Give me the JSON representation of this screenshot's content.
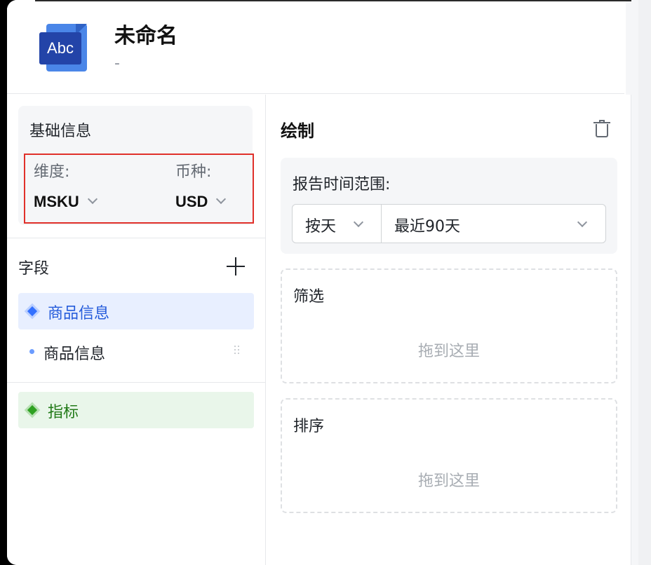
{
  "header": {
    "icon_text": "Abc",
    "title": "未命名",
    "subtitle": "-"
  },
  "basic_info": {
    "title": "基础信息",
    "dimension_label": "维度:",
    "dimension_value": "MSKU",
    "currency_label": "币种:",
    "currency_value": "USD"
  },
  "fields": {
    "title": "字段",
    "groups": [
      {
        "label": "商品信息",
        "color": "#3370ff"
      },
      {
        "label": "指标",
        "color": "#2ea121"
      }
    ],
    "items": [
      {
        "label": "商品信息"
      }
    ]
  },
  "draw": {
    "title": "绘制",
    "range_label": "报告时间范围:",
    "range_unit": "按天",
    "range_period": "最近90天",
    "filter_title": "筛选",
    "filter_hint": "拖到这里",
    "sort_title": "排序",
    "sort_hint": "拖到这里"
  },
  "icons": {
    "doc": "document-abc-icon",
    "add": "plus-icon",
    "delete": "trash-icon",
    "drag": "drag-handle-icon"
  }
}
